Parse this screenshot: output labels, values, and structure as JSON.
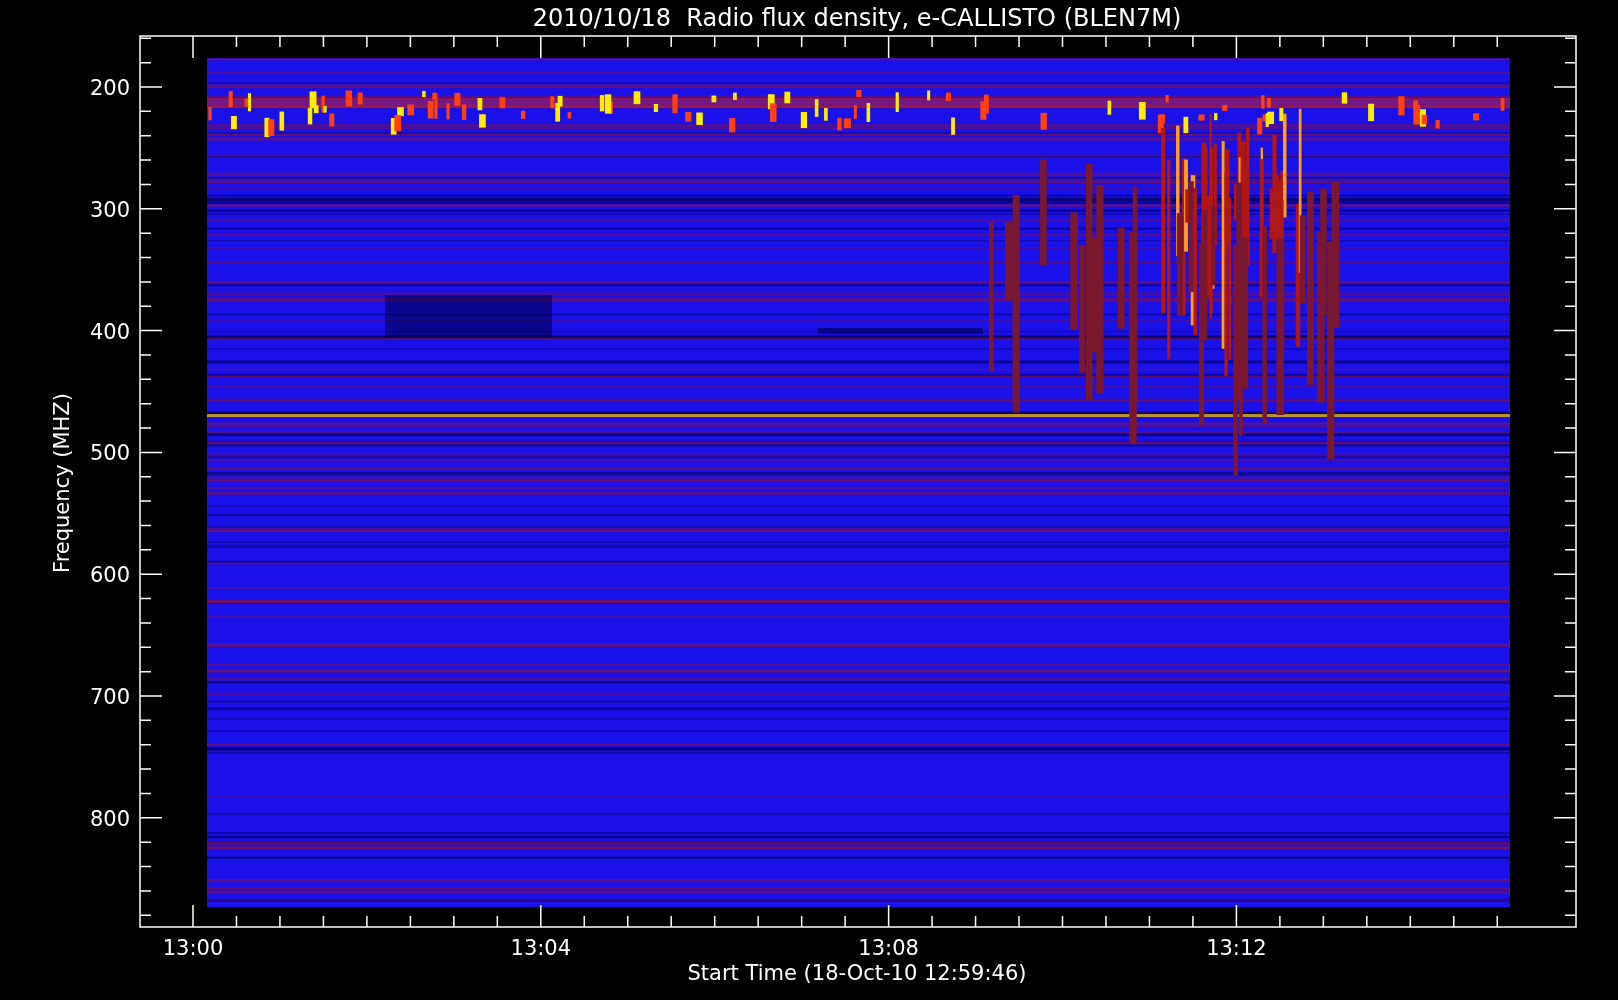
{
  "title": "2010/10/18  Radio flux density, e-CALLISTO (BLEN7M)",
  "y_axis": {
    "label": "Frequency (MHZ)",
    "ticks": [
      "200",
      "300",
      "400",
      "500",
      "600",
      "700",
      "800"
    ]
  },
  "x_axis": {
    "label": "Start Time (18-Oct-10 12:59:46)",
    "ticks": [
      "13:00",
      "13:04",
      "13:08",
      "13:12"
    ]
  }
}
